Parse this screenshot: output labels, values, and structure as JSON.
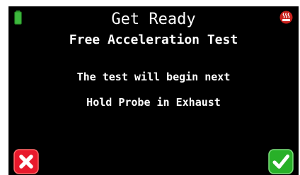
{
  "header": {
    "title": "Get Ready",
    "subtitle": "Free Acceleration Test",
    "battery_icon": "battery-icon",
    "status_icon": "heater-icon"
  },
  "message": {
    "line1": "The test will begin next",
    "line2": "Hold Probe in Exhaust"
  },
  "actions": {
    "cancel_icon": "x-icon",
    "confirm_icon": "checkmark-icon"
  },
  "colors": {
    "background": "#000000",
    "text": "#ffffff",
    "battery": "#3db83d",
    "cancel": "#e8192c",
    "confirm": "#28b028",
    "heater": "#c8201c"
  }
}
